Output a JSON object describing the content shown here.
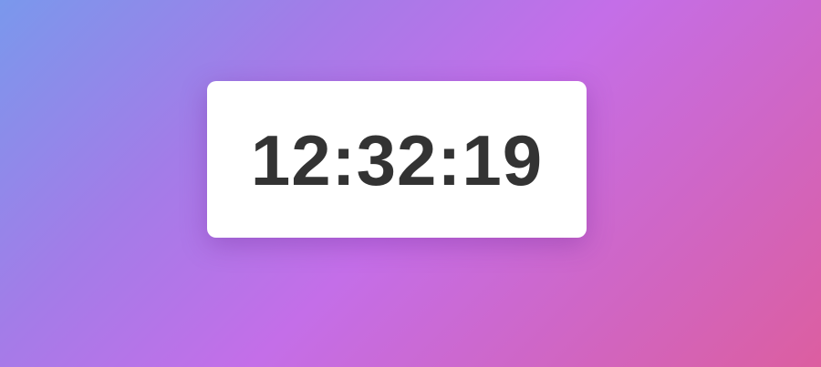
{
  "clock": {
    "time": "12:32:19"
  },
  "colors": {
    "card_background": "#ffffff",
    "time_text": "#333333",
    "gradient_start": "#7a98ec",
    "gradient_mid": "#c46ee8",
    "gradient_end": "#dc5ea0"
  }
}
